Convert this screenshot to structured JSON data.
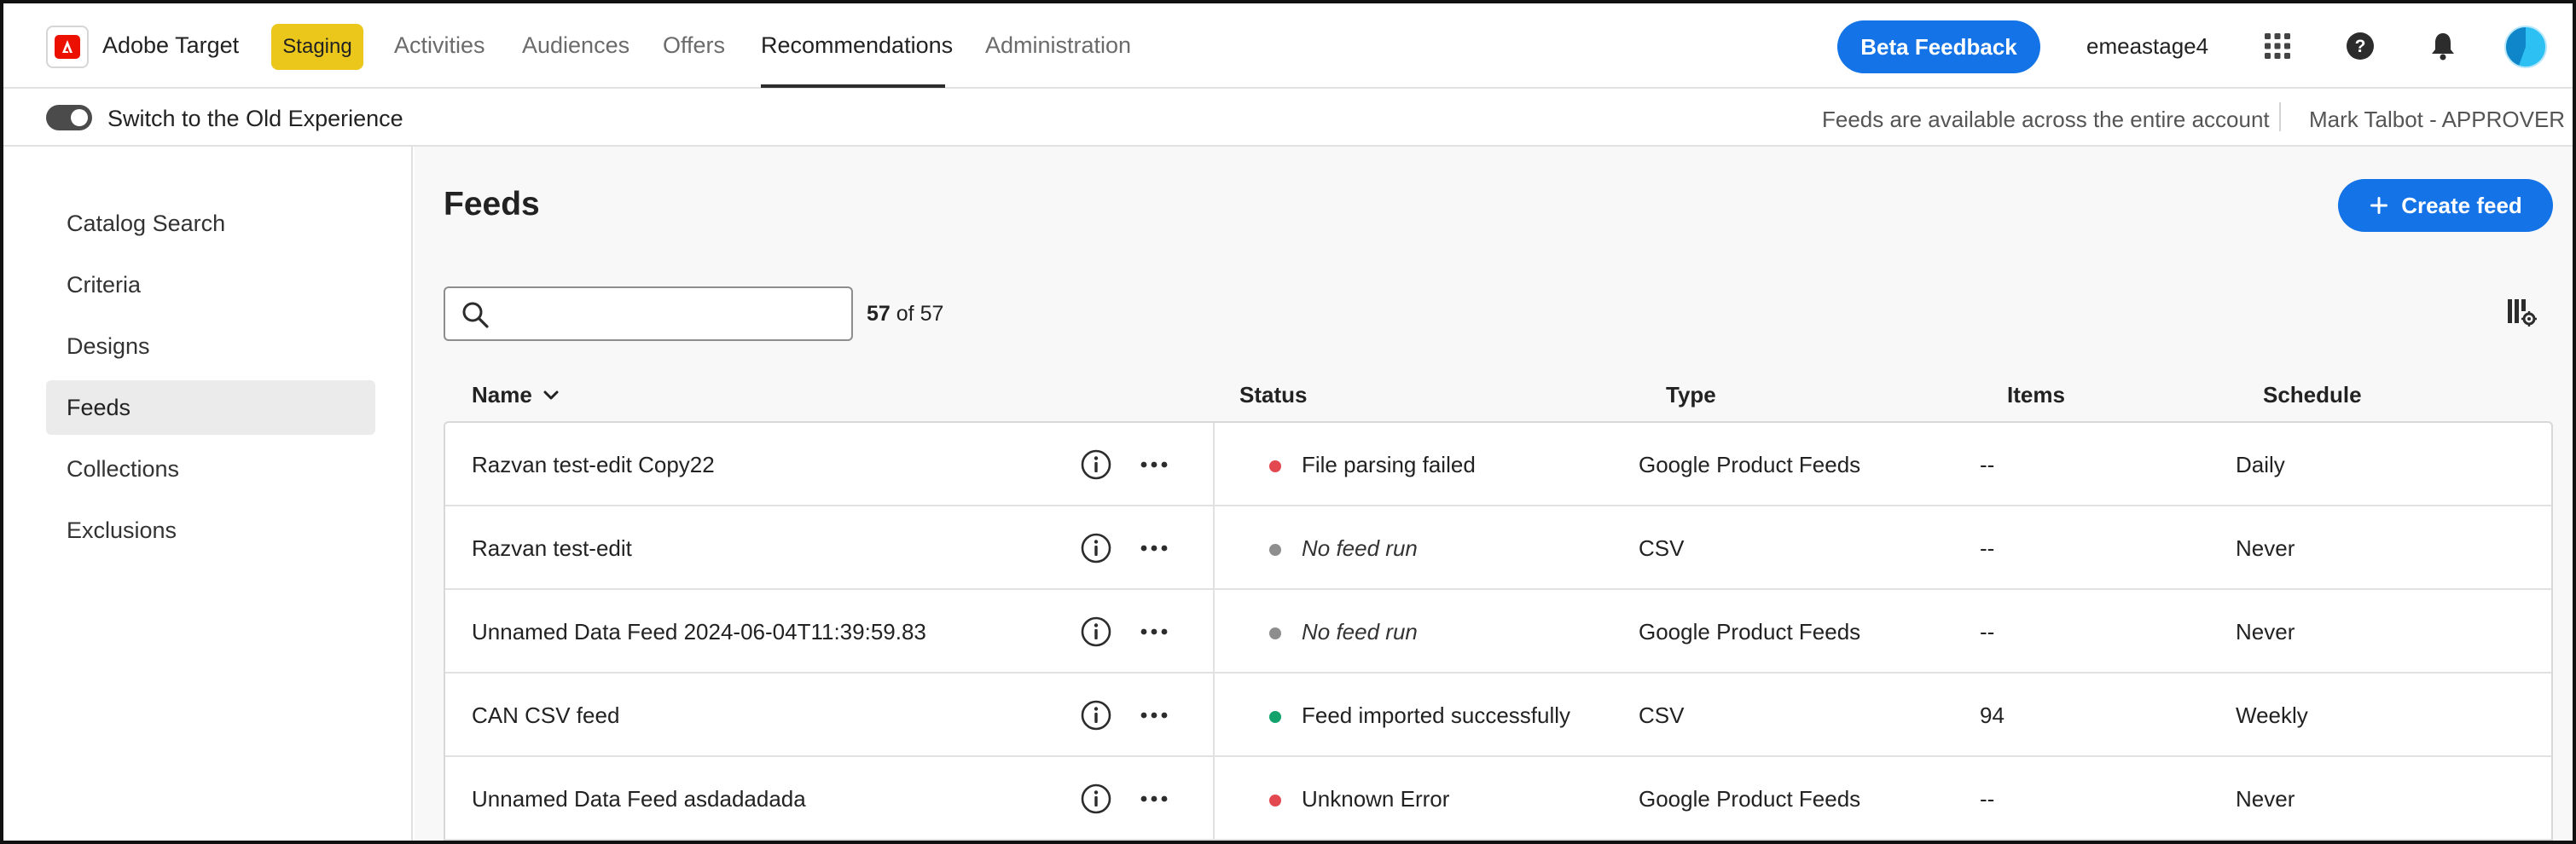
{
  "app": {
    "title": "Adobe Target",
    "environment_badge": "Staging",
    "nav": [
      {
        "label": "Activities",
        "active": false
      },
      {
        "label": "Audiences",
        "active": false
      },
      {
        "label": "Offers",
        "active": false
      },
      {
        "label": "Recommendations",
        "active": true
      },
      {
        "label": "Administration",
        "active": false
      }
    ],
    "beta_feedback_label": "Beta Feedback",
    "org_name": "emeastage4",
    "icons": [
      "apps-grid-icon",
      "help-icon",
      "notifications-bell-icon",
      "user-avatar"
    ]
  },
  "subbar": {
    "toggle_label": "Switch to the Old Experience",
    "toggle_on": true,
    "feeds_note": "Feeds are available across the entire account",
    "user_role": "Mark Talbot - APPROVER"
  },
  "sidebar": {
    "items": [
      {
        "label": "Catalog Search",
        "active": false
      },
      {
        "label": "Criteria",
        "active": false
      },
      {
        "label": "Designs",
        "active": false
      },
      {
        "label": "Feeds",
        "active": true
      },
      {
        "label": "Collections",
        "active": false
      },
      {
        "label": "Exclusions",
        "active": false
      }
    ]
  },
  "main": {
    "title": "Feeds",
    "create_button_label": "Create feed",
    "search": {
      "value": "",
      "placeholder": ""
    },
    "count": {
      "shown": "57",
      "separator": "of",
      "total": "57"
    },
    "columns": {
      "name": "Name",
      "status": "Status",
      "type": "Type",
      "items": "Items",
      "schedule": "Schedule"
    },
    "sort": {
      "column": "name",
      "direction": "descending"
    },
    "rows": [
      {
        "name": "Razvan test-edit Copy22",
        "status": "File parsing failed",
        "status_color": "#e34850",
        "status_italic": false,
        "type": "Google Product Feeds",
        "items": "--",
        "schedule": "Daily"
      },
      {
        "name": "Razvan test-edit",
        "status": "No feed run",
        "status_color": "#8e8e8e",
        "status_italic": true,
        "type": "CSV",
        "items": "--",
        "schedule": "Never"
      },
      {
        "name": "Unnamed Data Feed 2024-06-04T11:39:59.83",
        "status": "No feed run",
        "status_color": "#8e8e8e",
        "status_italic": true,
        "type": "Google Product Feeds",
        "items": "--",
        "schedule": "Never"
      },
      {
        "name": "CAN CSV feed",
        "status": "Feed imported successfully",
        "status_color": "#12a26c",
        "status_italic": false,
        "type": "CSV",
        "items": "94",
        "schedule": "Weekly"
      },
      {
        "name": "Unnamed Data Feed asdadadada",
        "status": "Unknown Error",
        "status_color": "#e34850",
        "status_italic": false,
        "type": "Google Product Feeds",
        "items": "--",
        "schedule": "Never"
      }
    ]
  },
  "colors": {
    "accent": "#1473e6",
    "staging_badge": "#ebc71c",
    "error": "#e34850",
    "success": "#12a26c",
    "neutral": "#8e8e8e"
  }
}
